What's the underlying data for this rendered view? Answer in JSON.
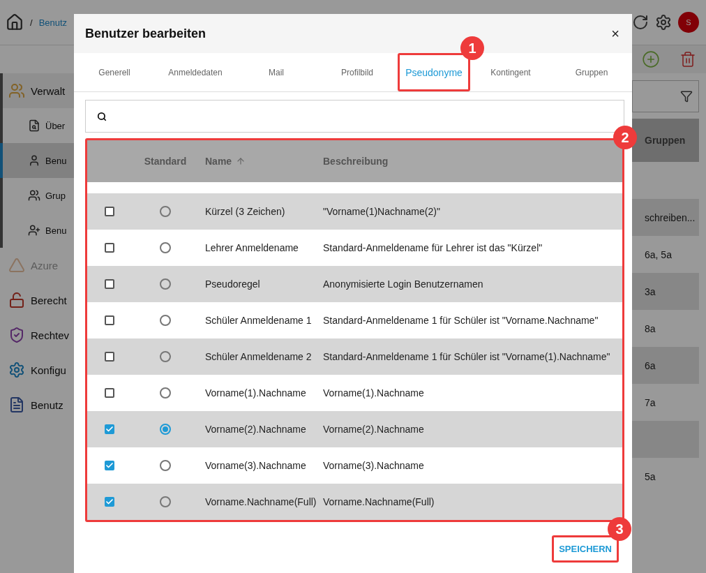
{
  "background": {
    "breadcrumb": {
      "separator": "/",
      "current": "Benutz"
    },
    "avatar": "S",
    "sidebar": [
      {
        "label": "Verwalt",
        "kind": "section",
        "selected": false,
        "disabled": false
      },
      {
        "label": "Über",
        "kind": "sub",
        "selected": false,
        "disabled": false
      },
      {
        "label": "Benu",
        "kind": "sub",
        "selected": true,
        "disabled": false
      },
      {
        "label": "Grup",
        "kind": "sub",
        "selected": false,
        "disabled": false
      },
      {
        "label": "Benu",
        "kind": "sub",
        "selected": false,
        "disabled": false
      },
      {
        "label": "Azure",
        "kind": "section",
        "selected": false,
        "disabled": true
      },
      {
        "label": "Berecht",
        "kind": "section",
        "selected": false,
        "disabled": false
      },
      {
        "label": "Rechtev",
        "kind": "section",
        "selected": false,
        "disabled": false
      },
      {
        "label": "Konfigu",
        "kind": "section",
        "selected": false,
        "disabled": false
      },
      {
        "label": "Benutz",
        "kind": "section",
        "selected": false,
        "disabled": false
      }
    ],
    "table": {
      "column": "Gruppen",
      "rows": [
        {},
        {
          "text": "schreiben..."
        },
        {
          "text": "6a, 5a"
        },
        {
          "text": "3a"
        },
        {
          "text": "8a"
        },
        {
          "text": "6a"
        },
        {
          "text": "7a"
        },
        {},
        {
          "text": "5a"
        }
      ]
    }
  },
  "dialog": {
    "title": "Benutzer bearbeiten",
    "close": "×",
    "tabs": [
      {
        "label": "Generell",
        "selected": false
      },
      {
        "label": "Anmeldedaten",
        "selected": false
      },
      {
        "label": "Mail",
        "selected": false
      },
      {
        "label": "Profilbild",
        "selected": false
      },
      {
        "label": "Pseudonyme",
        "selected": true
      },
      {
        "label": "Kontingent",
        "selected": false
      },
      {
        "label": "Gruppen",
        "selected": false
      }
    ],
    "table": {
      "columns": [
        "Standard",
        "Name",
        "Beschreibung"
      ],
      "rows": [
        {
          "name": "Kürzel (3 Zeichen)",
          "description": "\"Vorname(1)Nachname(2)\"",
          "checked": false,
          "standard": false
        },
        {
          "name": "Lehrer Anmeldename",
          "description": "Standard-Anmeldename für Lehrer ist das \"Kürzel\"",
          "checked": false,
          "standard": false
        },
        {
          "name": "Pseudoregel",
          "description": "Anonymisierte Login Benutzernamen",
          "checked": false,
          "standard": false
        },
        {
          "name": "Schüler Anmeldename 1",
          "description": "Standard-Anmeldename 1 für Schüler ist \"Vorname.Nachname\"",
          "checked": false,
          "standard": false
        },
        {
          "name": "Schüler Anmeldename 2",
          "description": "Standard-Anmeldename 1 für Schüler ist \"Vorname(1).Nachname\"",
          "checked": false,
          "standard": false
        },
        {
          "name": "Vorname(1).Nachname",
          "description": "Vorname(1).Nachname",
          "checked": false,
          "standard": false
        },
        {
          "name": "Vorname(2).Nachname",
          "description": "Vorname(2).Nachname",
          "checked": true,
          "standard": true
        },
        {
          "name": "Vorname(3).Nachname",
          "description": "Vorname(3).Nachname",
          "checked": true,
          "standard": false
        },
        {
          "name": "Vorname.Nachname(Full)",
          "description": "Vorname.Nachname(Full)",
          "checked": true,
          "standard": false
        }
      ]
    },
    "save_button": "SPEICHERN"
  },
  "annotations": [
    "1",
    "2",
    "3"
  ]
}
